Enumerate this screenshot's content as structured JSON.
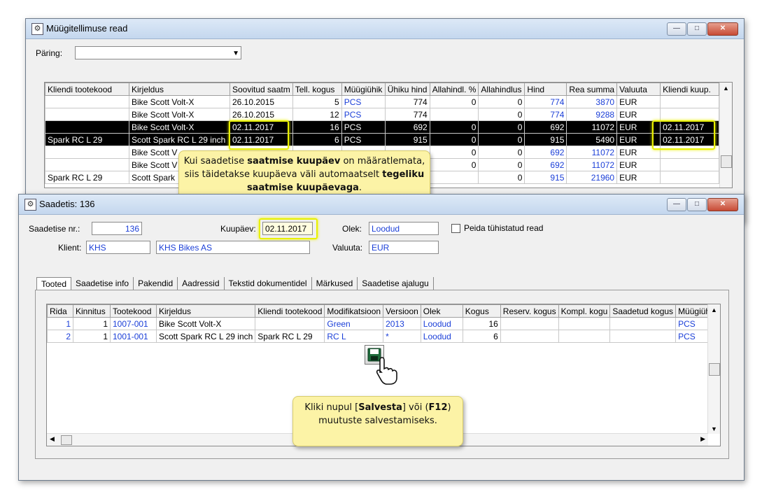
{
  "win1": {
    "title": "Müügitellimuse read",
    "query_label": "Päring:",
    "query_value": "",
    "columns": [
      "Kliendi tootekood",
      "Kirjeldus",
      "Soovitud saatm",
      "Tell. kogus",
      "Müügiühik",
      "Ühiku hind",
      "Allahindl. %",
      "Allahindlus",
      "Hind",
      "Rea summa",
      "Valuuta",
      "Kliendi kuup."
    ],
    "rows": [
      {
        "code": "",
        "desc": "Bike Scott Volt-X",
        "date": "26.10.2015",
        "qty": "5",
        "unit": "PCS",
        "price": "774",
        "pct": "0",
        "disc": "0",
        "hind": "774",
        "sum": "3870",
        "cur": "EUR",
        "kdate": ""
      },
      {
        "code": "",
        "desc": "Bike Scott Volt-X",
        "date": "26.10.2015",
        "qty": "12",
        "unit": "PCS",
        "price": "774",
        "pct": "",
        "disc": "0",
        "hind": "774",
        "sum": "9288",
        "cur": "EUR",
        "kdate": ""
      },
      {
        "code": "",
        "desc": "Bike Scott Volt-X",
        "date": "02.11.2017",
        "qty": "16",
        "unit": "PCS",
        "price": "692",
        "pct": "0",
        "disc": "0",
        "hind": "692",
        "sum": "11072",
        "cur": "EUR",
        "kdate": "02.11.2017"
      },
      {
        "code": "Spark RC L 29",
        "desc": "Scott Spark RC L 29 inch",
        "date": "02.11.2017",
        "qty": "6",
        "unit": "PCS",
        "price": "915",
        "pct": "0",
        "disc": "0",
        "hind": "915",
        "sum": "5490",
        "cur": "EUR",
        "kdate": "02.11.2017"
      },
      {
        "code": "",
        "desc": "Bike Scott V",
        "date": "",
        "qty": "",
        "unit": "",
        "price": "",
        "pct": "0",
        "disc": "0",
        "hind": "692",
        "sum": "11072",
        "cur": "EUR",
        "kdate": ""
      },
      {
        "code": "",
        "desc": "Bike Scott V",
        "date": "",
        "qty": "",
        "unit": "",
        "price": "",
        "pct": "0",
        "disc": "0",
        "hind": "692",
        "sum": "11072",
        "cur": "EUR",
        "kdate": ""
      },
      {
        "code": "Spark RC L 29",
        "desc": "Scott Spark",
        "date": "",
        "qty": "",
        "unit": "",
        "price": "",
        "pct": "",
        "disc": "0",
        "hind": "915",
        "sum": "21960",
        "cur": "EUR",
        "kdate": ""
      }
    ]
  },
  "callout1": {
    "p1": "Kui saadetise ",
    "b1": "saatmise kuupäev",
    "p2": " on määratlemata, siis täidetakse kuupäeva väli automaatselt ",
    "b2": "tegeliku saatmise kuupäevaga",
    "p3": "."
  },
  "win2": {
    "title": "Saadetis: 136",
    "nr_label": "Saadetise nr.:",
    "nr_value": "136",
    "date_label": "Kuupäev:",
    "date_value": "02.11.2017",
    "state_label": "Olek:",
    "state_value": "Loodud",
    "hide_label": "Peida tühistatud read",
    "client_label": "Klient:",
    "client_code": "KHS",
    "client_name": "KHS Bikes AS",
    "currency_label": "Valuuta:",
    "currency_value": "EUR",
    "tabs": [
      "Tooted",
      "Saadetise info",
      "Pakendid",
      "Aadressid",
      "Tekstid dokumentidel",
      "Märkused",
      "Saadetise ajalugu"
    ],
    "columns": [
      "Rida",
      "Kinnitus",
      "Tootekood",
      "Kirjeldus",
      "Kliendi tootekood",
      "Modifikatsioon",
      "Versioon",
      "Olek",
      "Kogus",
      "Reserv. kogus",
      "Kompl. kogu",
      "Saadetud kogus",
      "Müügiühik"
    ],
    "rows": [
      {
        "rida": "1",
        "kinn": "1",
        "code": "1007-001",
        "desc": "Bike Scott Volt-X",
        "kcode": "",
        "mod": "Green",
        "ver": "2013",
        "state": "Loodud",
        "qty": "16",
        "unit": "PCS"
      },
      {
        "rida": "2",
        "kinn": "1",
        "code": "1001-001",
        "desc": "Scott Spark RC L 29 inch",
        "kcode": "Spark RC L 29",
        "mod": "RC L",
        "ver": "*",
        "state": "Loodud",
        "qty": "6",
        "unit": "PCS"
      }
    ]
  },
  "callout2": {
    "p1": "Kliki nupul [",
    "b1": "Salvesta",
    "p2": "] või (",
    "b2": "F12",
    "p3": ")",
    "line2": "muutuste salvestamiseks."
  }
}
